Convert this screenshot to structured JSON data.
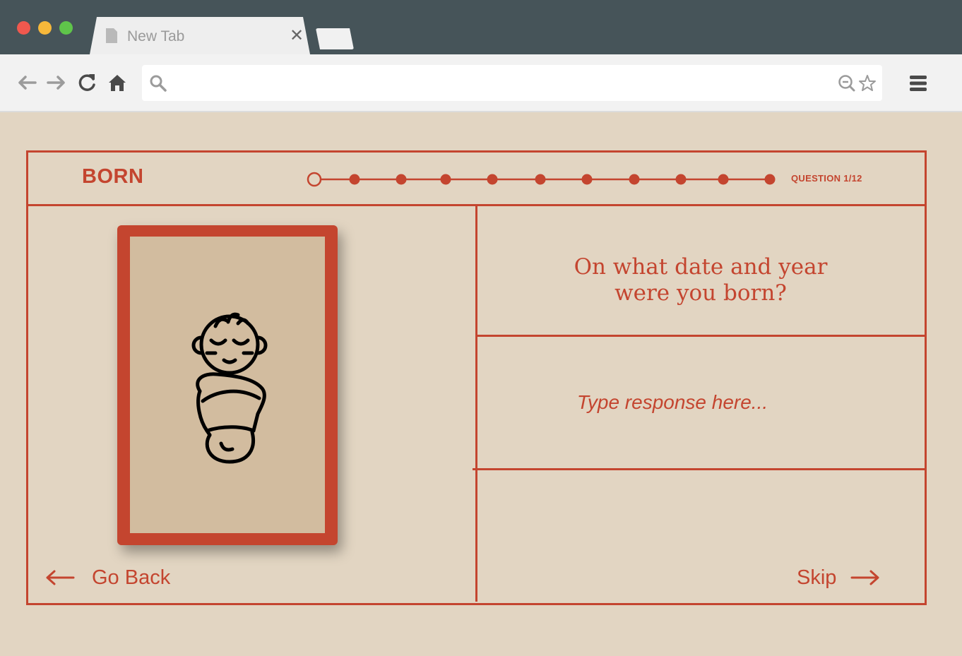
{
  "browser": {
    "tab_title": "New Tab",
    "tab_close": "✕",
    "icons": [
      "back-arrow-icon",
      "forward-arrow-icon",
      "reload-icon",
      "home-icon",
      "search-icon",
      "zoom-out-icon",
      "star-icon",
      "menu-icon"
    ]
  },
  "header": {
    "brand": "BORN",
    "question_count": "QUESTION 1/12",
    "progress": {
      "current": 1,
      "total": 11
    }
  },
  "question": {
    "line1": "On what date and year",
    "line2": "were you born?"
  },
  "response": {
    "placeholder": "Type response here...",
    "value": ""
  },
  "nav": {
    "back_label": "Go Back",
    "skip_label": "Skip"
  },
  "colors": {
    "accent": "#c4452f",
    "page_bg": "#e2d5c2",
    "card_inner": "#d2bc9f",
    "chrome_dark": "#465459"
  }
}
